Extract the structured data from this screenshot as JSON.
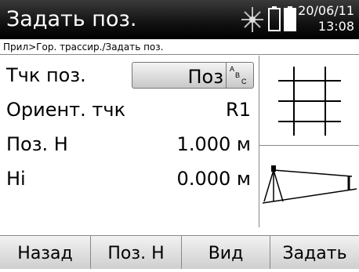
{
  "window": {
    "title": "Задать поз."
  },
  "status": {
    "date": "20/06/11",
    "time": "13:08"
  },
  "breadcrumb": "Прил>Гор. трассир./Задать поз.",
  "rows": [
    {
      "label": "Тчк поз.",
      "value": "Поз"
    },
    {
      "label": "Ориент. тчк",
      "value": "R1"
    },
    {
      "label": "Поз. Н",
      "value": "1.000 м"
    },
    {
      "label": "Hi",
      "value": "0.000 м"
    }
  ],
  "input_mode_indicator": "ABC",
  "softkeys": [
    "Назад",
    "Поз. Н",
    "Вид",
    "Задать"
  ]
}
